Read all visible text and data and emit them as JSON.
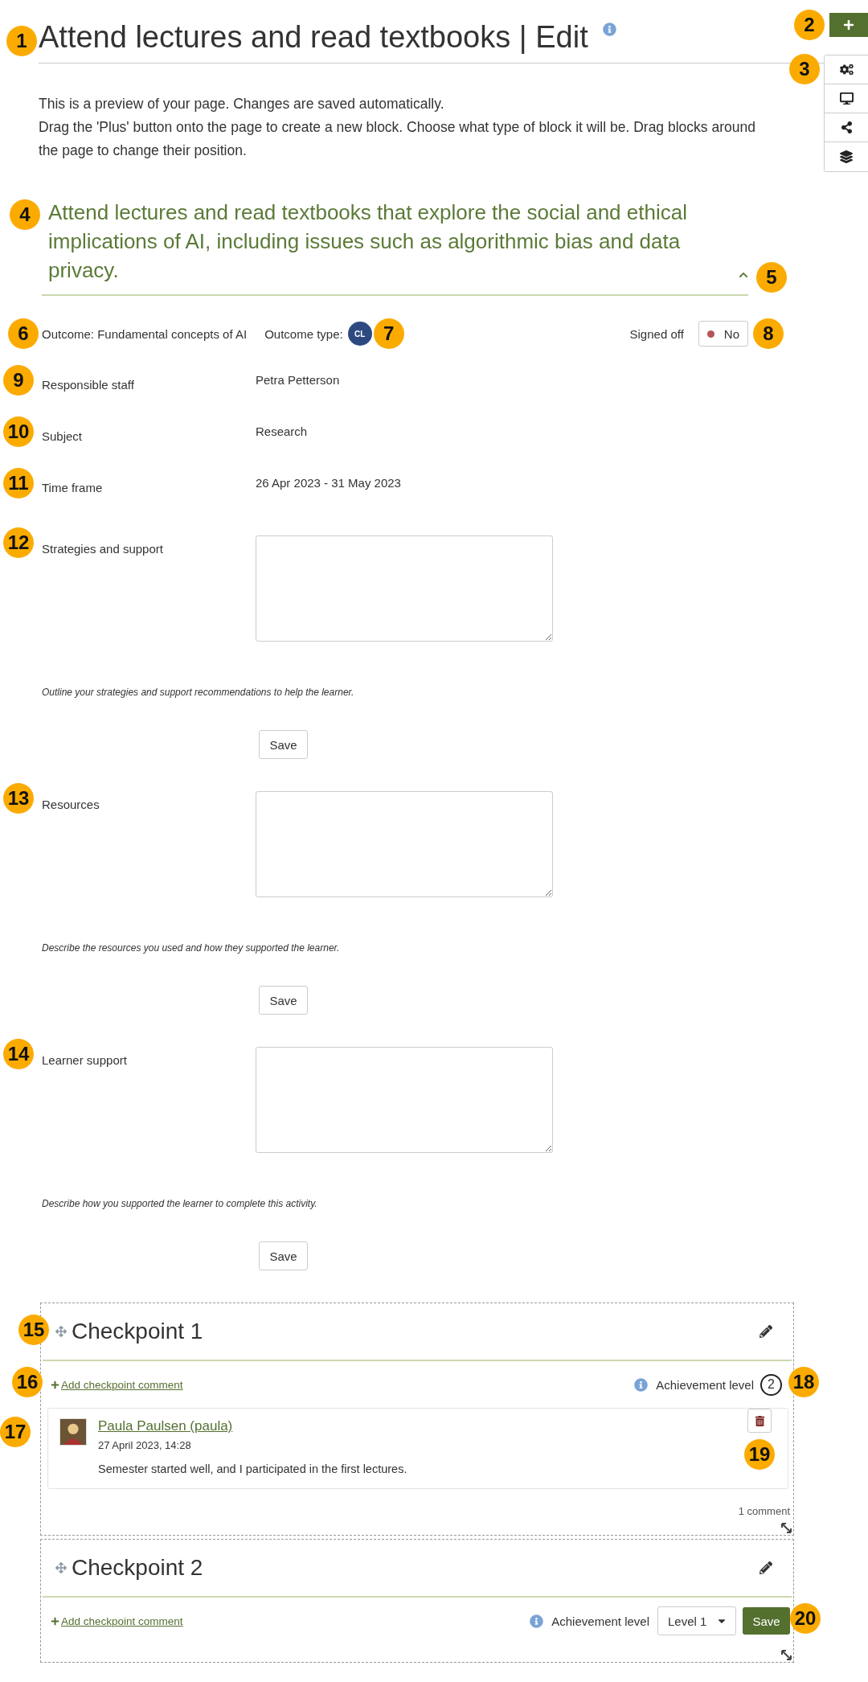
{
  "page": {
    "title": "Attend lectures and read textbooks | Edit",
    "callout": "1"
  },
  "toolbar": {
    "add_callout": "2",
    "side_callout": "3"
  },
  "description": [
    "This is a preview of your page. Changes are saved automatically.",
    "Drag the 'Plus' button onto the page to create a new block. Choose what type of block it will be. Drag blocks around the page to change their position."
  ],
  "heading": {
    "text": "Attend lectures and read textbooks that explore the social and ethical implications of AI, including issues such as algorithmic bias and data privacy.",
    "callout": "4",
    "expanded": true,
    "toggle_callout": "5"
  },
  "outcome": {
    "label": "Outcome: Fundamental concepts of AI",
    "callout": "6",
    "type_label": "Outcome type:",
    "type_badge": "CL",
    "type_callout": "7",
    "signed_off_label": "Signed off",
    "signed_off": false,
    "signed_off_value": "No",
    "signed_off_callout": "8"
  },
  "fields": [
    {
      "kind": "text",
      "label": "Responsible staff",
      "value": "Petra Petterson",
      "callout": "9"
    },
    {
      "kind": "text",
      "label": "Subject",
      "value": "Research",
      "callout": "10"
    },
    {
      "kind": "text",
      "label": "Time frame",
      "value": "26 Apr 2023 - 31 May 2023",
      "callout": "11"
    },
    {
      "kind": "textarea",
      "label": "Strategies and support",
      "hint": "Outline your strategies and support recommendations to help the learner.",
      "button": "Save",
      "callout": "12"
    },
    {
      "kind": "textarea",
      "label": "Resources",
      "hint": "Describe the resources you used and how they supported the learner.",
      "button": "Save",
      "callout": "13"
    },
    {
      "kind": "textarea",
      "label": "Learner support",
      "hint": "Describe how you supported the learner to complete this activity.",
      "button": "Save",
      "callout": "14"
    }
  ],
  "checkpoints": [
    {
      "title": "Checkpoint 1",
      "callout": "15",
      "add_comment": "Add checkpoint comment",
      "add_callout": "16",
      "achievement_label": "Achievement level",
      "achievement": {
        "kind": "display",
        "value": "2",
        "callout": "18"
      },
      "comments": [
        {
          "author": "Paula Paulsen (paula)",
          "date": "27 April 2023, 14:28",
          "text": "Semester started well, and I participated in the first lectures.",
          "callout": "17",
          "delete_callout": "19"
        }
      ],
      "comment_count": "1 comment"
    },
    {
      "title": "Checkpoint 2",
      "add_comment": "Add checkpoint comment",
      "achievement_label": "Achievement level",
      "achievement": {
        "kind": "select",
        "value": "Level 1",
        "button": "Save",
        "callout": "20"
      }
    }
  ]
}
